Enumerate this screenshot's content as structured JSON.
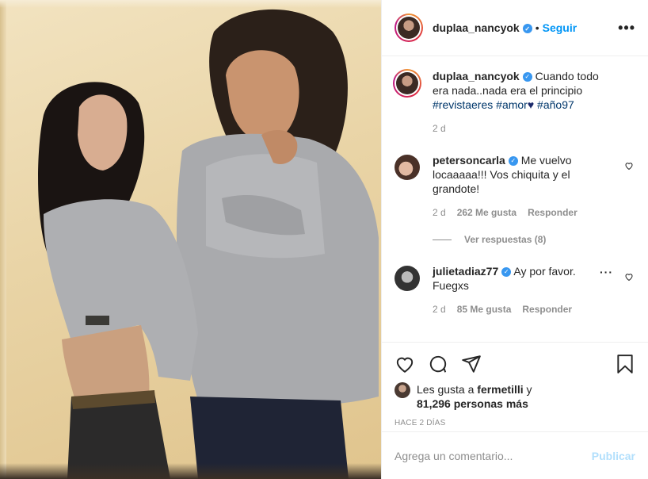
{
  "header": {
    "username": "duplaa_nancyok",
    "separator": "•",
    "follow_label": "Seguir",
    "more_label": "•••",
    "verified_icon": "check-icon"
  },
  "caption": {
    "username": "duplaa_nancyok",
    "text": "Cuando todo era nada..nada era el principio",
    "hashtags": [
      "#revistaeres",
      "#amor",
      "#año97"
    ],
    "time": "2 d"
  },
  "comments": [
    {
      "username": "petersoncarla",
      "text": "Me vuelvo locaaaaa!!! Vos chiquita y el grandote!",
      "time": "2 d",
      "likes": "262 Me gusta",
      "reply_label": "Responder",
      "view_replies": "Ver respuestas (8)"
    },
    {
      "username": "julietadiaz77",
      "text": "Ay por favor. Fuegxs",
      "time": "2 d",
      "likes": "85 Me gusta",
      "reply_label": "Responder"
    }
  ],
  "likes": {
    "prefix": "Les gusta a",
    "liker": "fermetilli",
    "conjunction": "y",
    "others": "81,296 personas más"
  },
  "date_label": "HACE 2 DÍAS",
  "add_comment": {
    "placeholder": "Agrega un comentario...",
    "publish_label": "Publicar"
  },
  "colors": {
    "accent": "#0095f6",
    "verified": "#3897f0",
    "muted": "#8e8e8e",
    "publish_disabled": "#b2dffc"
  }
}
